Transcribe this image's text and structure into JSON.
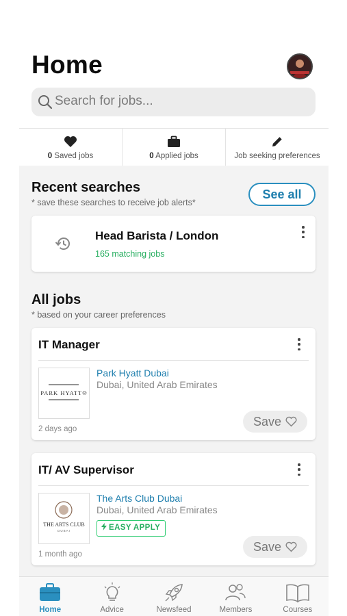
{
  "header": {
    "title": "Home",
    "search_placeholder": "Search for jobs..."
  },
  "stats": [
    {
      "count": "0",
      "label": "Saved jobs",
      "icon": "heart-icon"
    },
    {
      "count": "0",
      "label": "Applied jobs",
      "icon": "briefcase-icon"
    },
    {
      "count": "",
      "label": "Job seeking preferences",
      "icon": "pencil-icon"
    }
  ],
  "recent": {
    "title": "Recent searches",
    "note": "* save these searches to receive job alerts*",
    "see_all": "See all",
    "search_title": "Head Barista / London",
    "match_count": "165 matching jobs"
  },
  "all_jobs": {
    "title": "All jobs",
    "note": "* based on your career preferences",
    "jobs": [
      {
        "title": "IT Manager",
        "company": "Park Hyatt Dubai",
        "location": "Dubai, United Arab Emirates",
        "logo_text": "PARK HYATT®",
        "posted": "2 days ago",
        "save": "Save"
      },
      {
        "title": "IT/ AV Supervisor",
        "company": "The Arts Club Dubai",
        "location": "Dubai, United Arab Emirates",
        "logo_text": "THE ARTS CLUB",
        "logo_subtext": "DUBAI",
        "badge": "EASY APPLY",
        "posted": "1 month ago",
        "save": "Save"
      }
    ]
  },
  "nav": [
    {
      "label": "Home",
      "icon": "briefcase-icon",
      "active": true
    },
    {
      "label": "Advice",
      "icon": "lightbulb-icon"
    },
    {
      "label": "Newsfeed",
      "icon": "rocket-icon"
    },
    {
      "label": "Members",
      "icon": "people-icon"
    },
    {
      "label": "Courses",
      "icon": "book-icon"
    }
  ],
  "colors": {
    "accent": "#2a8fbf",
    "success": "#27ae60",
    "background": "#f3f3f3"
  }
}
